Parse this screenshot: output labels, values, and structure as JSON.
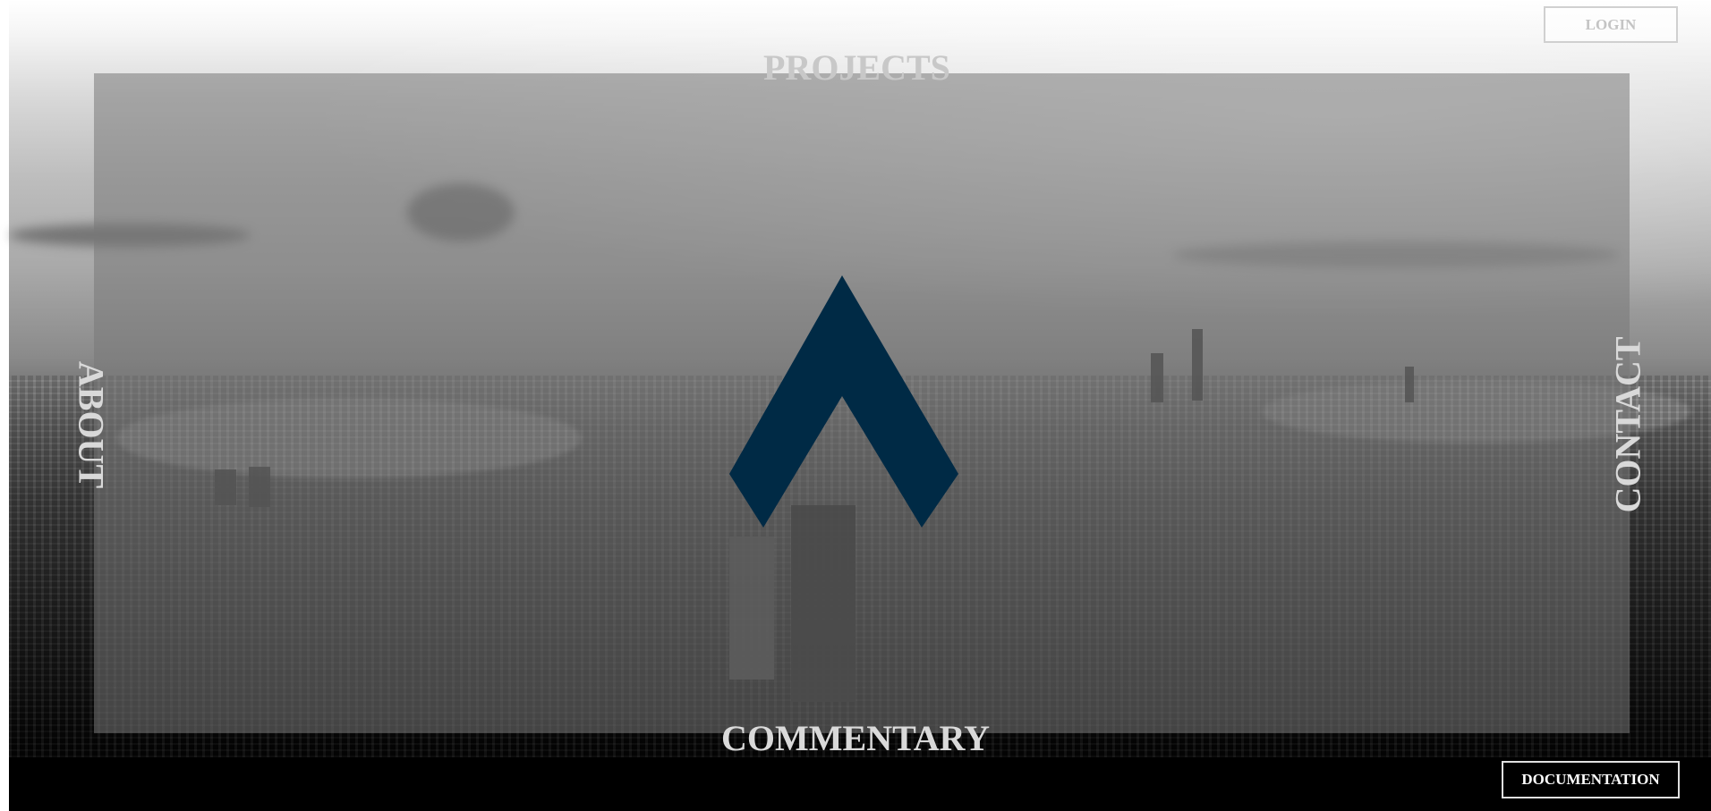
{
  "header": {
    "login_label": "LOGIN"
  },
  "nav": {
    "projects_label": "PROJECTS",
    "commentary_label": "COMMENTARY",
    "about_label": "ABOUT",
    "contact_label": "CONTACT"
  },
  "footer": {
    "documentation_label": "DOCUMENTATION"
  },
  "logo": {
    "icon": "chevron-up-logo-icon",
    "color": "#002a45"
  },
  "background": {
    "description_icon": "city-skyline-photo"
  },
  "colors": {
    "nav_text": "#d9d9d9",
    "overlay": "rgba(120,120,120,0.55)",
    "logo": "#002a45"
  }
}
